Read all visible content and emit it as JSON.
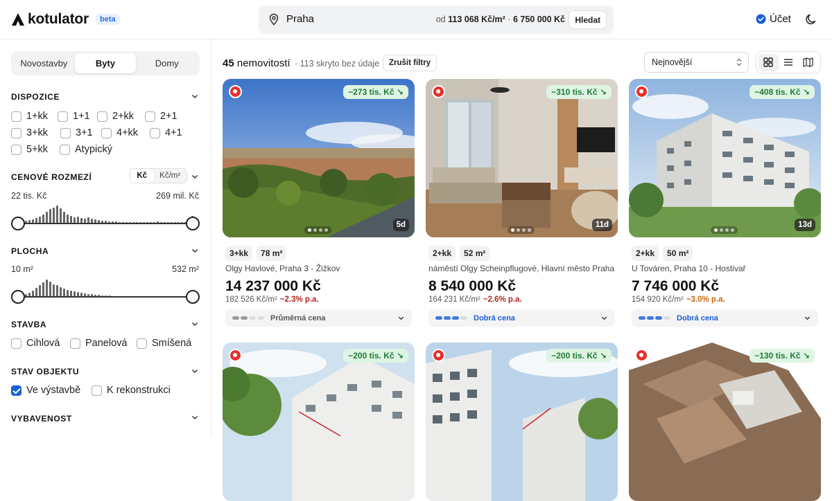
{
  "header": {
    "logo_text": "kotulator",
    "beta_label": "beta",
    "search_value": "Praha",
    "stats_prefix": "od ",
    "stats_price_sqm": "113 068 Kč/m²",
    "stats_sep": " · ",
    "stats_price": "6 750 000 Kč",
    "search_button": "Hledat",
    "account_label": "Účet",
    "accent": "#1a5fd4"
  },
  "sidebar": {
    "types": [
      "Novostavby",
      "Byty",
      "Domy"
    ],
    "active_type": "Byty",
    "dispozice_title": "DISPOZICE",
    "dispozice": [
      {
        "label": "1+kk",
        "checked": false
      },
      {
        "label": "1+1",
        "checked": false
      },
      {
        "label": "2+kk",
        "checked": false
      },
      {
        "label": "2+1",
        "checked": false
      },
      {
        "label": "3+kk",
        "checked": false
      },
      {
        "label": "3+1",
        "checked": false
      },
      {
        "label": "4+kk",
        "checked": false
      },
      {
        "label": "4+1",
        "checked": false
      },
      {
        "label": "5+kk",
        "checked": false
      },
      {
        "label": "Atypický",
        "checked": false
      }
    ],
    "price_title": "CENOVÉ ROZMEZÍ",
    "price_units": [
      "Kč",
      "Kč/m²"
    ],
    "price_min": "22 tis. Kč",
    "price_max": "269 mil. Kč",
    "area_title": "PLOCHA",
    "area_min": "10 m²",
    "area_max": "532 m²",
    "stavba_title": "STAVBA",
    "stavba": [
      {
        "label": "Cihlová",
        "checked": false
      },
      {
        "label": "Panelová",
        "checked": false
      },
      {
        "label": "Smíšená",
        "checked": false
      }
    ],
    "stav_title": "STAV OBJEKTU",
    "stav": [
      {
        "label": "Ve výstavbě",
        "checked": true
      },
      {
        "label": "K rekonstrukci",
        "checked": false
      }
    ],
    "vybavenost_title": "VYBAVENOST"
  },
  "main": {
    "count_number": "45",
    "count_label": " nemovitostí",
    "hidden_text": "· 113 skryto bez údaje",
    "clear_filters": "Zrušit filtry",
    "sort_value": "Nejnovější",
    "cards": [
      {
        "discount": "−273 tis. Kč ↘",
        "age": "5d",
        "disposition": "3+kk",
        "area": "78 m²",
        "address": "Olgy Havlové, Praha 3 - Žižkov",
        "price": "14 237 000 Kč",
        "price_sqm": "182 526 Kč/m²",
        "growth": "~2.3% p.a.",
        "growth_color": "#b3261e",
        "rating": "Průměrná cena",
        "rating_color": "#555",
        "rating_level": 2,
        "rating_bar_color": "#9a9a9a",
        "image": 0
      },
      {
        "discount": "−310 tis. Kč ↘",
        "age": "11d",
        "disposition": "2+kk",
        "area": "52 m²",
        "address": "náměstí Olgy Scheinpflugové, Hlavní město Praha",
        "price": "8 540 000 Kč",
        "price_sqm": "164 231 Kč/m²",
        "growth": "~2.6% p.a.",
        "growth_color": "#b3261e",
        "rating": "Dobrá cena",
        "rating_color": "#1a5fd4",
        "rating_level": 3,
        "rating_bar_color": "#3d7be0",
        "image": 1
      },
      {
        "discount": "−408 tis. Kč ↘",
        "age": "13d",
        "disposition": "2+kk",
        "area": "50 m²",
        "address": "U Továren, Praha 10 - Hostivař",
        "price": "7 746 000 Kč",
        "price_sqm": "154 920 Kč/m²",
        "growth": "~3.0% p.a.",
        "growth_color": "#c96a06",
        "rating": "Dobrá cena",
        "rating_color": "#1a5fd4",
        "rating_level": 3,
        "rating_bar_color": "#3d7be0",
        "image": 2
      },
      {
        "discount": "−200 tis. Kč ↘",
        "image": 3
      },
      {
        "discount": "−200 tis. Kč ↘",
        "image": 4
      },
      {
        "discount": "−130 tis. Kč ↘",
        "image": 5
      }
    ]
  }
}
